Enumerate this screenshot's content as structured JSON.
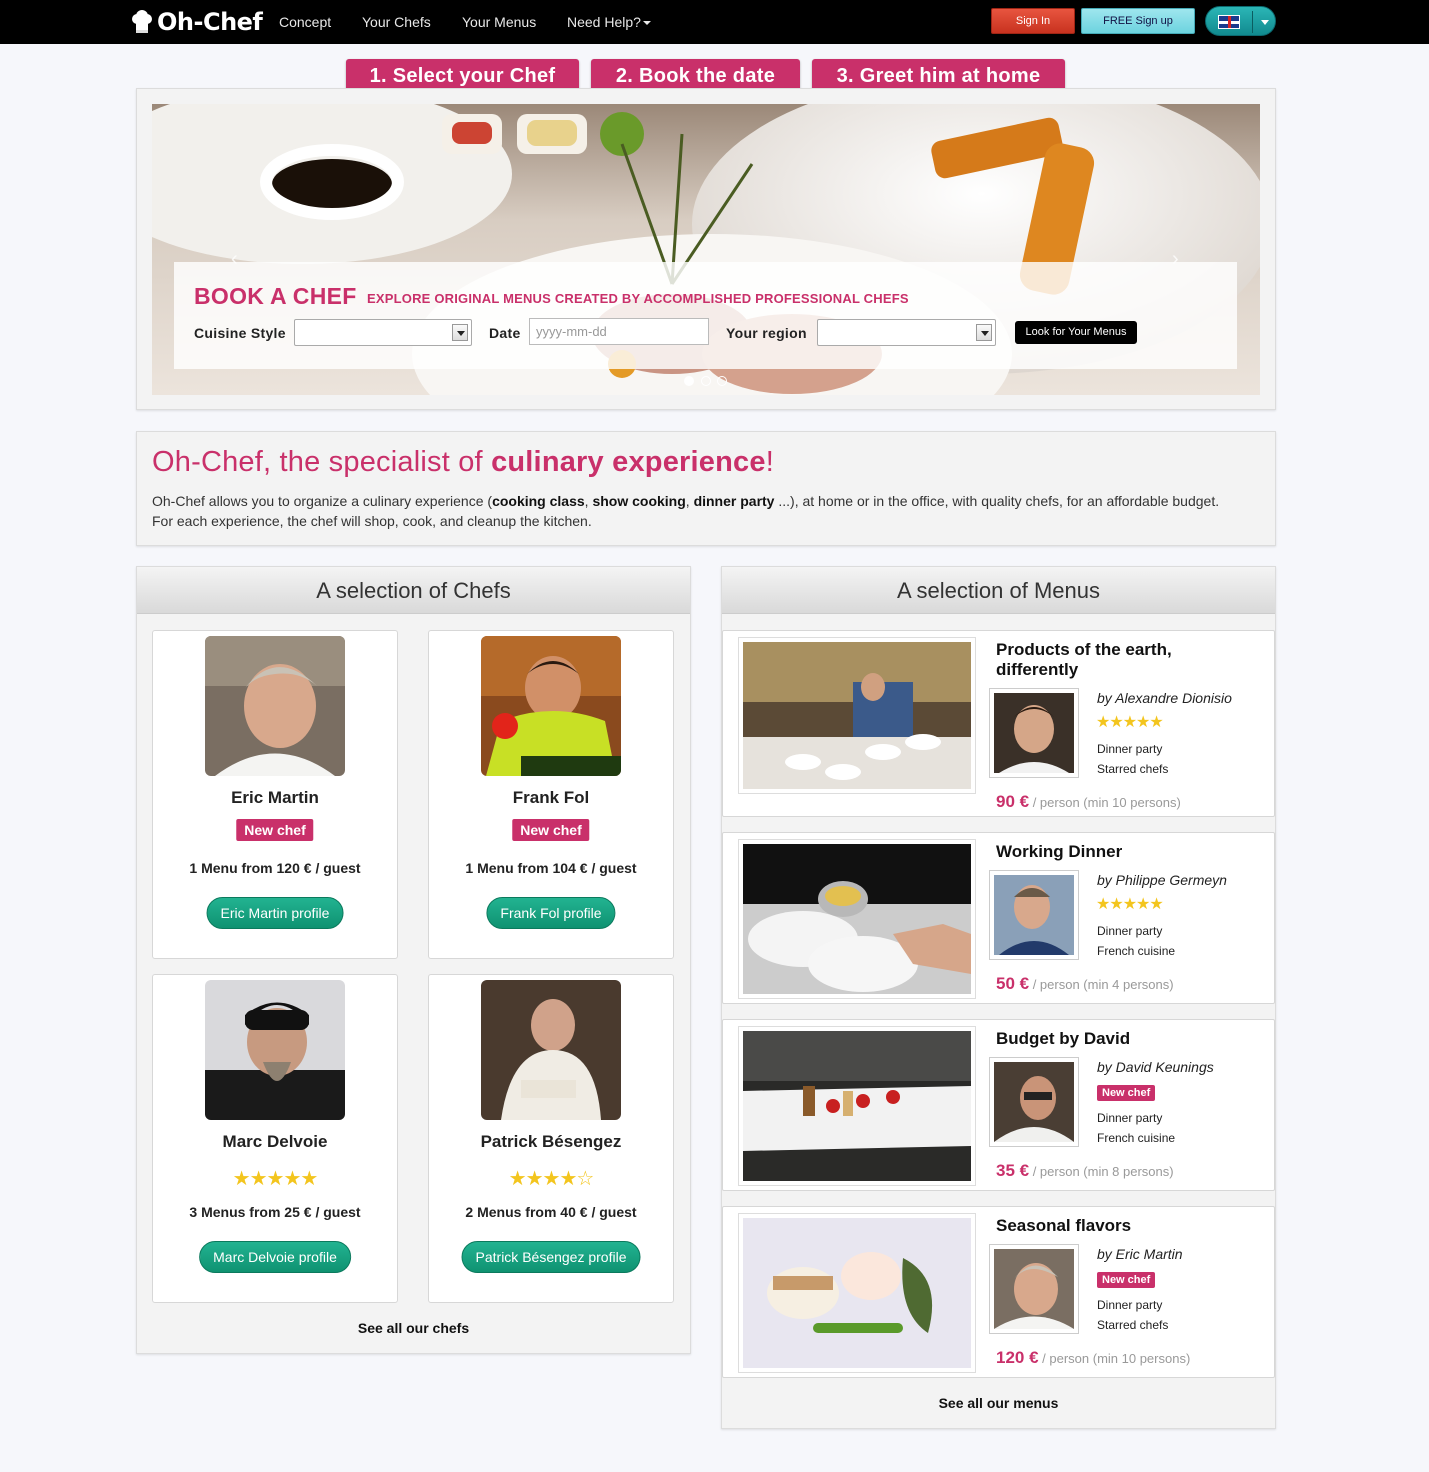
{
  "nav": {
    "brand": "Oh-Chef",
    "links": [
      "Concept",
      "Your Chefs",
      "Your Menus",
      "Need Help?"
    ],
    "sign_in": "Sign In",
    "sign_up": "FREE Sign up",
    "language_icon": "uk-flag-icon"
  },
  "steps": [
    "1. Select your Chef",
    "2. Book the date",
    "3. Greet him at home"
  ],
  "hero": {
    "title": "BOOK A CHEF",
    "subtitle": "EXPLORE ORIGINAL MENUS CREATED BY ACCOMPLISHED PROFESSIONAL CHEFS",
    "cuisine_label": "Cuisine Style",
    "date_label": "Date",
    "date_placeholder": "yyyy-mm-dd",
    "region_label": "Your region",
    "search_button": "Look for Your Menus",
    "prev_arrow": "‹",
    "next_arrow": "›"
  },
  "intro": {
    "title_a": "Oh-Chef, the specialist of ",
    "title_b": "culinary experience",
    "title_c": "!",
    "p1_a": "Oh-Chef allows you to organize a culinary experience (",
    "p1_b": "cooking class",
    "p1_c": ", ",
    "p1_d": "show cooking",
    "p1_e": ", ",
    "p1_f": "dinner party",
    "p1_g": " ...), at home or in the office, with quality chefs, for an affordable budget.",
    "p2": "For each experience, the chef will shop, cook, and cleanup the kitchen."
  },
  "chefs_section": {
    "title": "A selection of Chefs",
    "see_all": "See all our chefs",
    "chefs": [
      {
        "name": "Eric Martin",
        "badge": "New chef",
        "price": "1 Menu from 120 € / guest",
        "button": "Eric Martin profile"
      },
      {
        "name": "Frank Fol",
        "badge": "New chef",
        "price": "1 Menu from 104 € / guest",
        "button": "Frank Fol profile"
      },
      {
        "name": "Marc Delvoie",
        "stars": "★★★★★",
        "rating": 5,
        "price": "3 Menus from 25 € / guest",
        "button": "Marc Delvoie profile"
      },
      {
        "name": "Patrick Bésengez",
        "stars": "★★★★☆",
        "rating": 4,
        "price": "2 Menus from 40 € / guest",
        "button": "Patrick Bésengez profile"
      }
    ]
  },
  "menus_section": {
    "title": "A selection of Menus",
    "see_all": "See all our menus",
    "menus": [
      {
        "title": "Products of the earth, differently",
        "by": "by Alexandre Dionisio",
        "stars": "★★★★★",
        "rating": 5,
        "tag1": "Dinner party",
        "tag2": "Starred chefs",
        "price": "90 €",
        "per": " / person (min 10 persons)"
      },
      {
        "title": "Working Dinner",
        "by": "by Philippe Germeyn",
        "stars": "★★★★★",
        "rating": 5,
        "tag1": "Dinner party",
        "tag2": "French cuisine",
        "price": "50 €",
        "per": " / person (min 4 persons)"
      },
      {
        "title": "Budget by David",
        "by": "by David Keunings",
        "badge": "New chef",
        "tag1": "Dinner party",
        "tag2": "French cuisine",
        "price": "35 €",
        "per": " / person (min 8 persons)"
      },
      {
        "title": "Seasonal flavors",
        "by": "by Eric Martin",
        "badge": "New chef",
        "tag1": "Dinner party",
        "tag2": "Starred chefs",
        "price": "120 €",
        "per": " / person (min 10 persons)"
      }
    ]
  },
  "colors": {
    "brand": "#c9306a",
    "profile_button": "#13a07f",
    "star": "#f3c51e"
  }
}
